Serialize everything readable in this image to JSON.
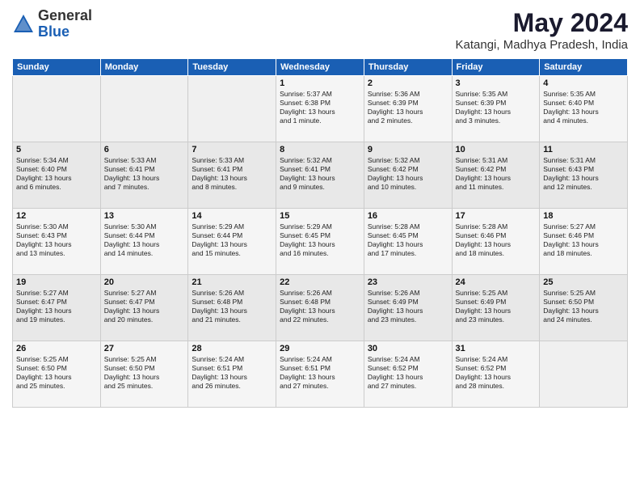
{
  "logo": {
    "general": "General",
    "blue": "Blue"
  },
  "title": {
    "month_year": "May 2024",
    "location": "Katangi, Madhya Pradesh, India"
  },
  "weekdays": [
    "Sunday",
    "Monday",
    "Tuesday",
    "Wednesday",
    "Thursday",
    "Friday",
    "Saturday"
  ],
  "weeks": [
    [
      {
        "day": "",
        "text": ""
      },
      {
        "day": "",
        "text": ""
      },
      {
        "day": "",
        "text": ""
      },
      {
        "day": "1",
        "text": "Sunrise: 5:37 AM\nSunset: 6:38 PM\nDaylight: 13 hours\nand 1 minute."
      },
      {
        "day": "2",
        "text": "Sunrise: 5:36 AM\nSunset: 6:39 PM\nDaylight: 13 hours\nand 2 minutes."
      },
      {
        "day": "3",
        "text": "Sunrise: 5:35 AM\nSunset: 6:39 PM\nDaylight: 13 hours\nand 3 minutes."
      },
      {
        "day": "4",
        "text": "Sunrise: 5:35 AM\nSunset: 6:40 PM\nDaylight: 13 hours\nand 4 minutes."
      }
    ],
    [
      {
        "day": "5",
        "text": "Sunrise: 5:34 AM\nSunset: 6:40 PM\nDaylight: 13 hours\nand 6 minutes."
      },
      {
        "day": "6",
        "text": "Sunrise: 5:33 AM\nSunset: 6:41 PM\nDaylight: 13 hours\nand 7 minutes."
      },
      {
        "day": "7",
        "text": "Sunrise: 5:33 AM\nSunset: 6:41 PM\nDaylight: 13 hours\nand 8 minutes."
      },
      {
        "day": "8",
        "text": "Sunrise: 5:32 AM\nSunset: 6:41 PM\nDaylight: 13 hours\nand 9 minutes."
      },
      {
        "day": "9",
        "text": "Sunrise: 5:32 AM\nSunset: 6:42 PM\nDaylight: 13 hours\nand 10 minutes."
      },
      {
        "day": "10",
        "text": "Sunrise: 5:31 AM\nSunset: 6:42 PM\nDaylight: 13 hours\nand 11 minutes."
      },
      {
        "day": "11",
        "text": "Sunrise: 5:31 AM\nSunset: 6:43 PM\nDaylight: 13 hours\nand 12 minutes."
      }
    ],
    [
      {
        "day": "12",
        "text": "Sunrise: 5:30 AM\nSunset: 6:43 PM\nDaylight: 13 hours\nand 13 minutes."
      },
      {
        "day": "13",
        "text": "Sunrise: 5:30 AM\nSunset: 6:44 PM\nDaylight: 13 hours\nand 14 minutes."
      },
      {
        "day": "14",
        "text": "Sunrise: 5:29 AM\nSunset: 6:44 PM\nDaylight: 13 hours\nand 15 minutes."
      },
      {
        "day": "15",
        "text": "Sunrise: 5:29 AM\nSunset: 6:45 PM\nDaylight: 13 hours\nand 16 minutes."
      },
      {
        "day": "16",
        "text": "Sunrise: 5:28 AM\nSunset: 6:45 PM\nDaylight: 13 hours\nand 17 minutes."
      },
      {
        "day": "17",
        "text": "Sunrise: 5:28 AM\nSunset: 6:46 PM\nDaylight: 13 hours\nand 18 minutes."
      },
      {
        "day": "18",
        "text": "Sunrise: 5:27 AM\nSunset: 6:46 PM\nDaylight: 13 hours\nand 18 minutes."
      }
    ],
    [
      {
        "day": "19",
        "text": "Sunrise: 5:27 AM\nSunset: 6:47 PM\nDaylight: 13 hours\nand 19 minutes."
      },
      {
        "day": "20",
        "text": "Sunrise: 5:27 AM\nSunset: 6:47 PM\nDaylight: 13 hours\nand 20 minutes."
      },
      {
        "day": "21",
        "text": "Sunrise: 5:26 AM\nSunset: 6:48 PM\nDaylight: 13 hours\nand 21 minutes."
      },
      {
        "day": "22",
        "text": "Sunrise: 5:26 AM\nSunset: 6:48 PM\nDaylight: 13 hours\nand 22 minutes."
      },
      {
        "day": "23",
        "text": "Sunrise: 5:26 AM\nSunset: 6:49 PM\nDaylight: 13 hours\nand 23 minutes."
      },
      {
        "day": "24",
        "text": "Sunrise: 5:25 AM\nSunset: 6:49 PM\nDaylight: 13 hours\nand 23 minutes."
      },
      {
        "day": "25",
        "text": "Sunrise: 5:25 AM\nSunset: 6:50 PM\nDaylight: 13 hours\nand 24 minutes."
      }
    ],
    [
      {
        "day": "26",
        "text": "Sunrise: 5:25 AM\nSunset: 6:50 PM\nDaylight: 13 hours\nand 25 minutes."
      },
      {
        "day": "27",
        "text": "Sunrise: 5:25 AM\nSunset: 6:50 PM\nDaylight: 13 hours\nand 25 minutes."
      },
      {
        "day": "28",
        "text": "Sunrise: 5:24 AM\nSunset: 6:51 PM\nDaylight: 13 hours\nand 26 minutes."
      },
      {
        "day": "29",
        "text": "Sunrise: 5:24 AM\nSunset: 6:51 PM\nDaylight: 13 hours\nand 27 minutes."
      },
      {
        "day": "30",
        "text": "Sunrise: 5:24 AM\nSunset: 6:52 PM\nDaylight: 13 hours\nand 27 minutes."
      },
      {
        "day": "31",
        "text": "Sunrise: 5:24 AM\nSunset: 6:52 PM\nDaylight: 13 hours\nand 28 minutes."
      },
      {
        "day": "",
        "text": ""
      }
    ]
  ]
}
